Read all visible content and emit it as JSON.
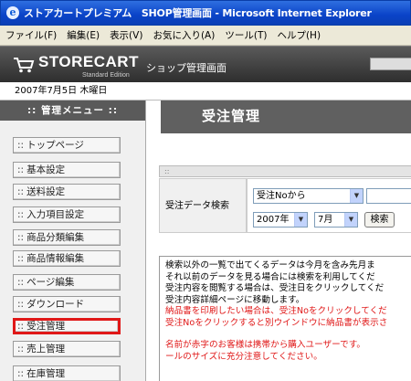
{
  "window": {
    "title": "ストアカートプレミアム　SHOP管理画面 - Microsoft Internet Explorer"
  },
  "menu": [
    "ファイル(F)",
    "編集(E)",
    "表示(V)",
    "お気に入り(A)",
    "ツール(T)",
    "ヘルプ(H)"
  ],
  "header": {
    "logo": "STORECART",
    "logo_sub": "Standard Edition",
    "title": "ショップ管理画面"
  },
  "date": "2007年7月5日 木曜日",
  "sidebar": {
    "title": ":: 管理メニュー ::",
    "items": [
      {
        "dots": "::",
        "label": "トップページ"
      },
      {
        "dots": "::",
        "label": "基本設定"
      },
      {
        "dots": "::",
        "label": "送料設定"
      },
      {
        "dots": "::",
        "label": "入力項目設定"
      },
      {
        "dots": "::",
        "label": "商品分類編集"
      },
      {
        "dots": "::",
        "label": "商品情報編集"
      },
      {
        "dots": "::",
        "label": "ページ編集"
      },
      {
        "dots": "::",
        "label": "ダウンロード"
      },
      {
        "dots": "::",
        "label": "受注管理"
      },
      {
        "dots": "::",
        "label": "売上管理"
      },
      {
        "dots": "::",
        "label": "在庫管理"
      }
    ],
    "active_index": 8
  },
  "main": {
    "title": "受注管理",
    "section_marker": "::",
    "search_label": "受注データ検索",
    "search_type": "受注Noから",
    "year": "2007年",
    "month": "7月",
    "search_button": "検索",
    "notice": {
      "lines": [
        "検索以外の一覧で出てくるデータは今月を含み先月ま",
        "それ以前のデータを見る場合には検索を利用してくだ",
        "受注内容を閲覧する場合は、受注日をクリックしてくだ",
        "受注内容詳細ページに移動します。"
      ],
      "red_lines": [
        "納品書を印刷したい場合は、受注Noをクリックしてくだ",
        "受注Noをクリックすると別ウインドウに納品書が表示さ"
      ],
      "red_lines2": [
        "名前が赤字のお客様は携帯から購入ユーザーです。",
        "ールのサイズに充分注意してください。"
      ]
    }
  },
  "colors": {
    "titlebar": "#0a43c8",
    "header": "#3a3a3a",
    "active_border": "#e01818",
    "notice_red": "#e01818"
  }
}
